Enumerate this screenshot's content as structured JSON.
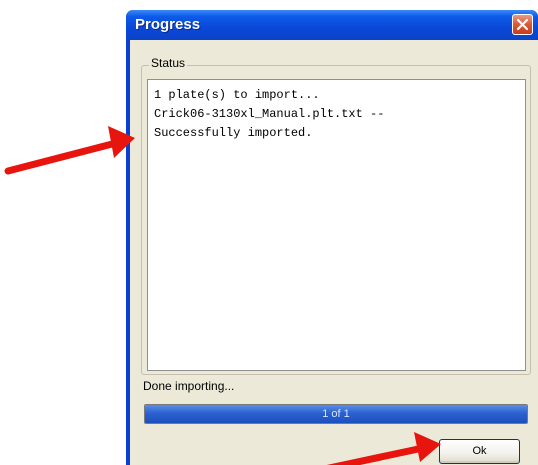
{
  "window": {
    "title": "Progress",
    "close_icon": "close-x-icon"
  },
  "status": {
    "group_label": "Status",
    "lines": [
      "1 plate(s) to import...",
      "Crick06-3130xl_Manual.plt.txt --",
      "Successfully imported."
    ]
  },
  "footer": {
    "done_text": "Done importing...",
    "progress_text": "1 of 1",
    "progress_fraction": 1.0,
    "ok_label": "Ok"
  },
  "annotations": {
    "arrow_icon": "red-arrow-icon",
    "color": "#e8150f"
  }
}
